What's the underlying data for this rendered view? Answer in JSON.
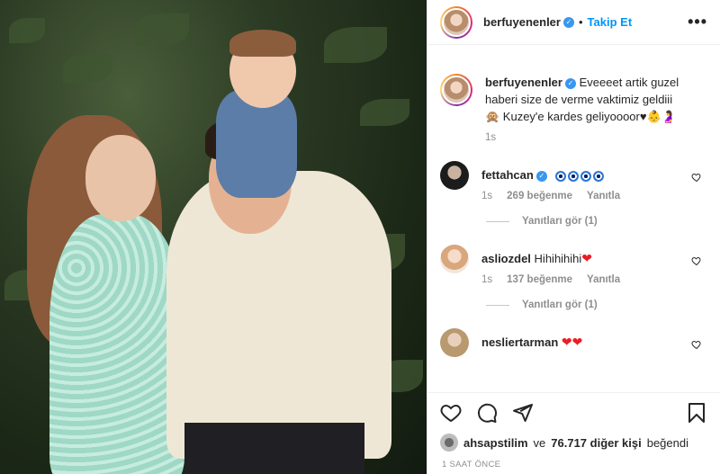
{
  "post": {
    "author": "berfuyenenler",
    "follow_label": "Takip Et",
    "more_label": "•••",
    "caption_lines": [
      "Eveeeet artik guzel",
      "haberi size de verme vaktimiz geldiii",
      "🙊 Kuzey'e kardes geliyoooor♥👶🤰"
    ],
    "caption_time": "1s"
  },
  "comments": [
    {
      "user": "fettahcan",
      "text": "",
      "eyes": 4,
      "time": "1s",
      "likes": "269 beğenme",
      "reply": "Yanıtla",
      "view_replies": "Yanıtları gör (1)"
    },
    {
      "user": "asliozdel",
      "text": "Hihihihihi",
      "time": "1s",
      "likes": "137 beğenme",
      "reply": "Yanıtla",
      "view_replies": "Yanıtları gör (1)"
    },
    {
      "user": "nesliertarman",
      "text": ""
    }
  ],
  "likes_summary": {
    "user": "ahsapstilim",
    "connector": "ve",
    "count": "76.717 diğer kişi",
    "suffix": "beğendi"
  },
  "timestamp": "1 SAAT ÖNCE",
  "icons": {
    "like": "heart-icon",
    "comment": "comment-icon",
    "share": "paper-plane-icon",
    "save": "bookmark-icon",
    "verified": "verified-badge-icon",
    "more": "ellipsis-icon"
  },
  "colors": {
    "link": "#0095f6",
    "verified": "#3897f0",
    "meta": "#8e8e8e"
  }
}
